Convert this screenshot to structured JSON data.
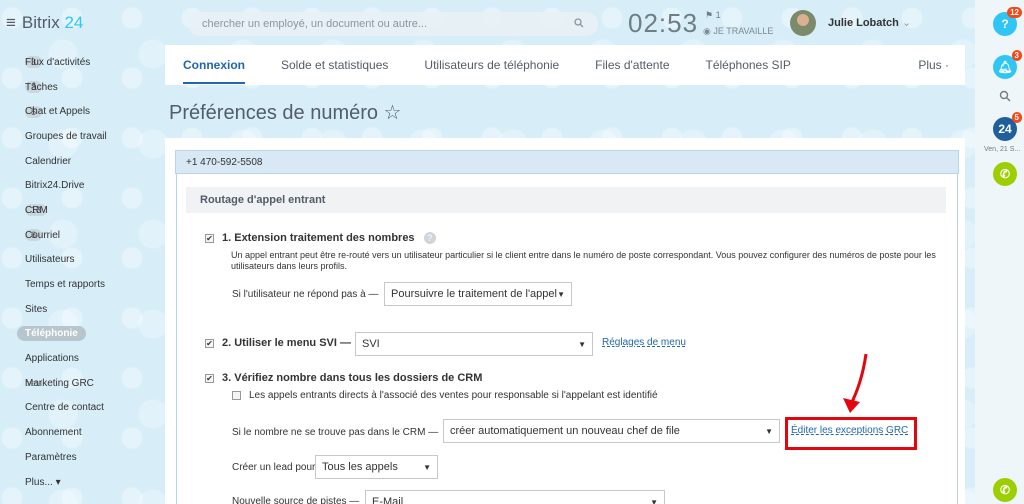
{
  "app": {
    "logo_text": "Bitrix",
    "logo_num": "24"
  },
  "sidebar": {
    "items": [
      {
        "label": "Flux d'activités",
        "count": "3"
      },
      {
        "label": "Tâches",
        "count": "3"
      },
      {
        "label": "Chat et Appels",
        "count": "5"
      },
      {
        "label": "Groupes de travail"
      },
      {
        "label": "Calendrier"
      },
      {
        "label": "Bitrix24.Drive"
      },
      {
        "label": "CRM",
        "count": "13"
      },
      {
        "label": "Courriel",
        "count": "6"
      },
      {
        "label": "Utilisateurs"
      },
      {
        "label": "Temps et rapports"
      },
      {
        "label": "Sites"
      },
      {
        "label": "Téléphonie",
        "active": true
      },
      {
        "label": "Applications"
      },
      {
        "label": "Marketing GRC",
        "beta": "beta"
      },
      {
        "label": "Centre de contact"
      },
      {
        "label": "Abonnement"
      },
      {
        "label": "Paramètres"
      },
      {
        "label": "Plus... ▾"
      }
    ]
  },
  "header": {
    "search_placeholder": "chercher un employé, un document ou autre...",
    "clock": "02:53",
    "flag_count": "1",
    "work_state": "JE TRAVAILLE",
    "user_name": "Julie Lobatch"
  },
  "rightbar": {
    "help_badge": "12",
    "notif_badge": "3",
    "b24_badge": "5",
    "date": "Ven, 21 S..."
  },
  "tabs": [
    {
      "label": "Connexion",
      "active": true
    },
    {
      "label": "Solde et statistiques"
    },
    {
      "label": "Utilisateurs de téléphonie"
    },
    {
      "label": "Files d'attente"
    },
    {
      "label": "Téléphones SIP"
    }
  ],
  "tabs_more": "Plus ·",
  "page_title": "Préférences de numéro ☆",
  "number": "+1 470-592-5508",
  "section_title": "Routage d'appel entrant",
  "opt1": {
    "label": "1. Extension traitement des nombres",
    "desc": "Un appel entrant peut être re-routé vers un utilisateur particulier si le client entre dans le numéro de poste correspondant. Vous pouvez configurer des numéros de poste pour les utilisateurs dans leurs profils.",
    "no_answer_label": "Si l'utilisateur ne répond pas à —",
    "no_answer_value": "Poursuivre le traitement de l'appel"
  },
  "opt2": {
    "label": "2. Utiliser le menu SVI —",
    "value": "SVI",
    "link": "Réglages de menu"
  },
  "opt3": {
    "label": "3. Vérifiez nombre dans tous les dossiers de CRM",
    "sub": "Les appels entrants directs à l'associé des ventes pour responsable si l'appelant est identifié",
    "notfound_label": "Si le nombre ne se trouve pas dans le CRM —",
    "notfound_value": "créer automatiquement un nouveau chef de file",
    "exceptions_link": "Éditer les exceptions GRC",
    "lead_label": "Créer un lead pour",
    "lead_value": "Tous les appels",
    "source_label": "Nouvelle source de pistes —",
    "source_value": "E-Mail"
  }
}
